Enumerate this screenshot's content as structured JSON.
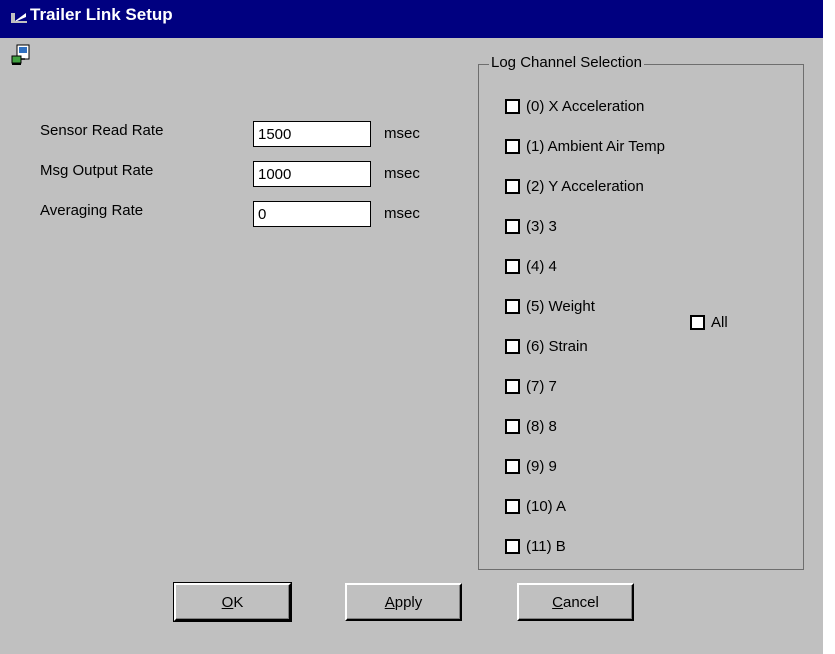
{
  "window": {
    "title": "Trailer Link Setup",
    "title_icon": "trailer-window-icon",
    "app_icon": "network-link-icon"
  },
  "fields": [
    {
      "label": "Sensor Read Rate",
      "value": "1500",
      "unit": "msec"
    },
    {
      "label": "Msg Output Rate",
      "value": "1000",
      "unit": "msec"
    },
    {
      "label": "Averaging Rate",
      "value": "0",
      "unit": "msec"
    }
  ],
  "log_channels": {
    "title": "Log Channel Selection",
    "channels": [
      {
        "label": "(0) X Acceleration",
        "checked": false
      },
      {
        "label": "(1) Ambient Air Temp",
        "checked": false
      },
      {
        "label": "(2) Y Acceleration",
        "checked": false
      },
      {
        "label": "(3) 3",
        "checked": false
      },
      {
        "label": "(4) 4",
        "checked": false
      },
      {
        "label": "(5) Weight",
        "checked": false
      },
      {
        "label": "(6) Strain",
        "checked": false
      },
      {
        "label": "(7) 7",
        "checked": false
      },
      {
        "label": "(8) 8",
        "checked": false
      },
      {
        "label": "(9) 9",
        "checked": false
      },
      {
        "label": "(10) A",
        "checked": false
      },
      {
        "label": "(11) B",
        "checked": false
      }
    ],
    "all_label": "All"
  },
  "buttons": {
    "ok": {
      "mnemonic": "O",
      "rest": "K"
    },
    "apply": {
      "mnemonic": "A",
      "rest": "pply"
    },
    "cancel": {
      "mnemonic": "C",
      "rest": "ancel"
    }
  },
  "colors": {
    "titlebar": "#000080",
    "face": "#c0c0c0"
  }
}
